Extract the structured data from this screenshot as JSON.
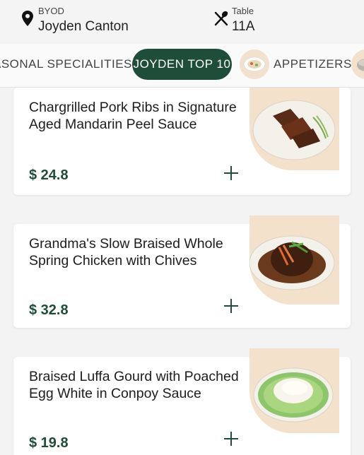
{
  "header": {
    "store_label": "BYOD",
    "store_name": "Joyden Canton",
    "table_label": "Table",
    "table_number": "11A",
    "store_icon": "location-pin-icon",
    "table_icon": "utensils-icon"
  },
  "tabs": [
    {
      "label": "ASONAL SPECIALITIES"
    },
    {
      "label": "JOYDEN TOP 10"
    },
    {
      "label": "APPETIZERS"
    },
    {
      "label": ""
    }
  ],
  "colors": {
    "accent": "#1e4d3a",
    "thumb_bg": "#f3e1cb"
  },
  "dishes": [
    {
      "name": "Chargrilled Pork Ribs in Signature Aged Mandarin Peel Sauce",
      "price": "$ 24.8"
    },
    {
      "name": "Grandma's Slow Braised Whole Spring Chicken with Chives",
      "price": "$ 32.8"
    },
    {
      "name": "Braised Luffa Gourd with Poached Egg White in Conpoy Sauce",
      "price": "$ 19.8"
    }
  ]
}
